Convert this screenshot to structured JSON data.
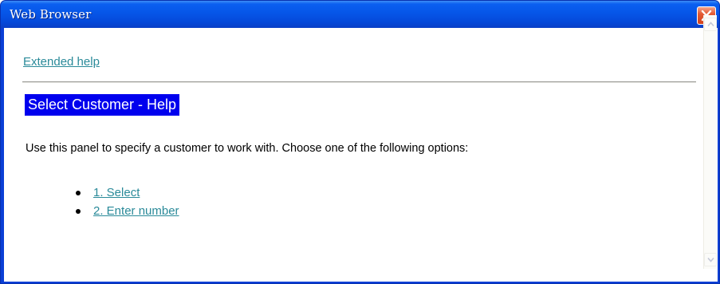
{
  "window": {
    "title": "Web Browser",
    "close_icon": "close-x-icon"
  },
  "help": {
    "extended_help_link": "Extended help",
    "heading": "Select Customer - Help",
    "description": "Use this panel to specify a customer to work with. Choose one of the following options:",
    "options": [
      {
        "label": "1. Select"
      },
      {
        "label": "2. Enter number"
      }
    ]
  },
  "scrollbar": {
    "up_icon": "scroll-up-arrow-icon",
    "down_icon": "scroll-down-arrow-icon"
  },
  "colors": {
    "titlebar": "#0656e8",
    "link": "#2a8a99",
    "heading_bg": "#0000ee",
    "close_button": "#d2421c"
  }
}
